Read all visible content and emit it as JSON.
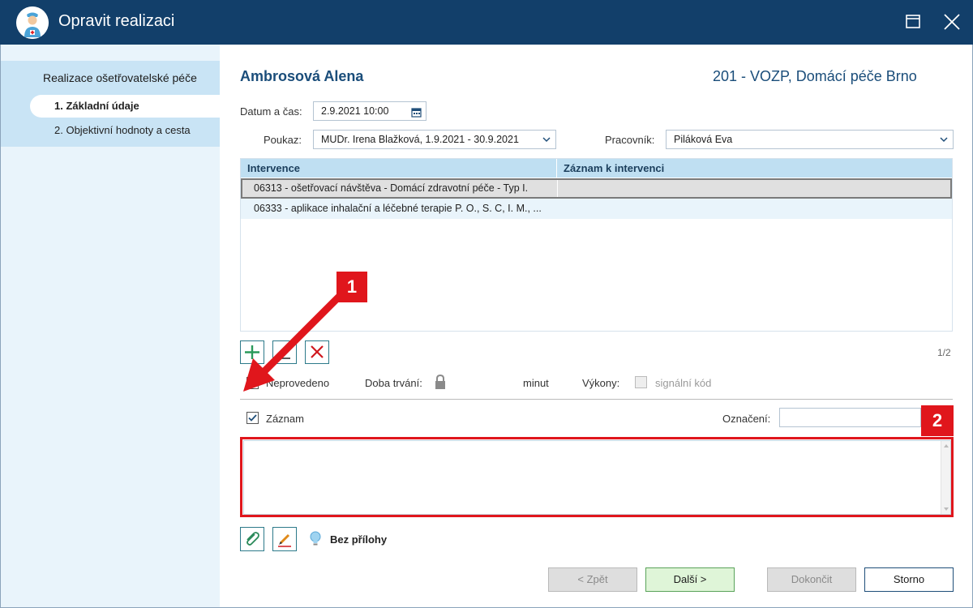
{
  "window": {
    "title": "Opravit realizaci"
  },
  "sidebar": {
    "heading": "Realizace ošetřovatelské péče",
    "steps": [
      {
        "label": "1. Základní údaje",
        "active": true
      },
      {
        "label": "2. Objektivní hodnoty a cesta",
        "active": false
      }
    ]
  },
  "header": {
    "patient": "Ambrosová Alena",
    "provider": "201 - VOZP, Domácí péče Brno"
  },
  "form": {
    "datetime_label": "Datum a čas:",
    "datetime_value": "2.9.2021 10:00",
    "poukaz_label": "Poukaz:",
    "poukaz_value": "MUDr. Irena Blažková, 1.9.2021 - 30.9.2021",
    "worker_label": "Pracovník:",
    "worker_value": "Piláková Eva"
  },
  "grid": {
    "columns": [
      "Intervence",
      "Záznam k intervenci"
    ],
    "rows": [
      {
        "intervence": "06313 - ošetřovací návštěva - Domácí zdravotní péče - Typ I.",
        "zaznam": ""
      },
      {
        "intervence": "06333 - aplikace inhalační a léčebné terapie P. O., S. C, I. M., ...",
        "zaznam": ""
      }
    ],
    "pager": "1/2"
  },
  "options": {
    "neprovedeno_label": "Neprovedeno",
    "neprovedeno_checked": true,
    "duration_label": "Doba trvání:",
    "minutes_label": "minut",
    "vykony_label": "Výkony:",
    "signal_label": "signální kód"
  },
  "record": {
    "zaznam_label": "Záznam",
    "zaznam_checked": true,
    "oznaceni_label": "Označení:",
    "oznaceni_value": "",
    "text": ""
  },
  "attachments": {
    "label": "Bez přílohy"
  },
  "footer": {
    "back": "< Zpět",
    "next": "Další >",
    "finish": "Dokončit",
    "cancel": "Storno"
  },
  "annotations": {
    "badge1": "1",
    "badge2": "2"
  },
  "colors": {
    "titlebar": "#123f6a",
    "accent": "#1a4d7a",
    "highlight": "#e0161c",
    "sidebar": "#e9f4fb"
  }
}
